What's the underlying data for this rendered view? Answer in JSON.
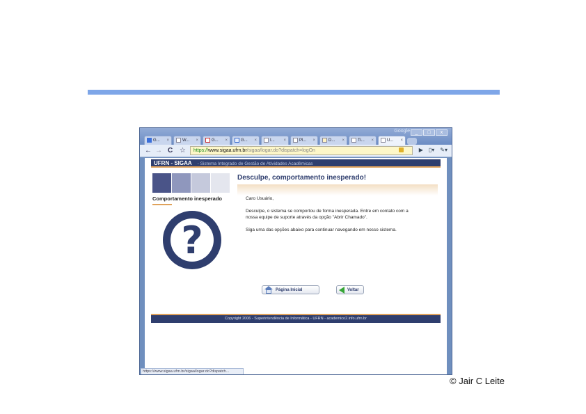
{
  "slide": {
    "credit": "© Jair C Leite",
    "accent_color": "#7ea6e8"
  },
  "browser": {
    "google_label": "Google",
    "window_controls": [
      "_",
      "□",
      "x"
    ],
    "tabs": [
      {
        "label": "G...",
        "icon": "google-icon"
      },
      {
        "label": "W...",
        "icon": "page-icon"
      },
      {
        "label": "G...",
        "icon": "gmail-icon"
      },
      {
        "label": "G...",
        "icon": "calendar-icon"
      },
      {
        "label": "I...",
        "icon": "page-icon"
      },
      {
        "label": "Pl...",
        "icon": "page-icon"
      },
      {
        "label": "D...",
        "icon": "doc-icon"
      },
      {
        "label": "Ti...",
        "icon": "page-icon"
      },
      {
        "label": "U...",
        "icon": "page-icon",
        "active": true
      }
    ],
    "nav": {
      "back": "←",
      "forward": "→",
      "reload": "C",
      "star": "☆"
    },
    "address": {
      "scheme": "https://",
      "host": "www.sigaa.ufrn.br",
      "path": "/sigaa/logar.do?dispatch=logOn"
    },
    "status_url": "https://www.sigaa.ufrn.br/sigaa/logar.do?dispatch..."
  },
  "site": {
    "brand": "UFRN - SIGAA",
    "subtitle": "- Sistema Integrado de Gestão de Atividades Acadêmicas",
    "footer": "Copyright 2006 - Superintendência de Informática - UFRN - academico2.info.ufrn.br",
    "primary_color": "#2f3e6e",
    "highlight_color": "#e0a25b"
  },
  "sidebar": {
    "title": "Comportamento inesperado",
    "swatches": [
      "#4a5488",
      "#8f97bd",
      "#c5c9dc",
      "#e4e6ee"
    ],
    "icon": "question-mark-icon"
  },
  "error": {
    "title": "Desculpe, comportamento inesperado!",
    "greeting": "Caro Usuário,",
    "paragraph1": "Desculpe, o sistema se comportou de forma inesperada. Entre em contato com a nossa equipe de suporte através da opção \"Abrir Chamado\".",
    "paragraph2": "Siga uma das opções abaixo para continuar navegando em nosso sistema."
  },
  "actions": {
    "home": "Página Inicial",
    "back": "Voltar"
  }
}
